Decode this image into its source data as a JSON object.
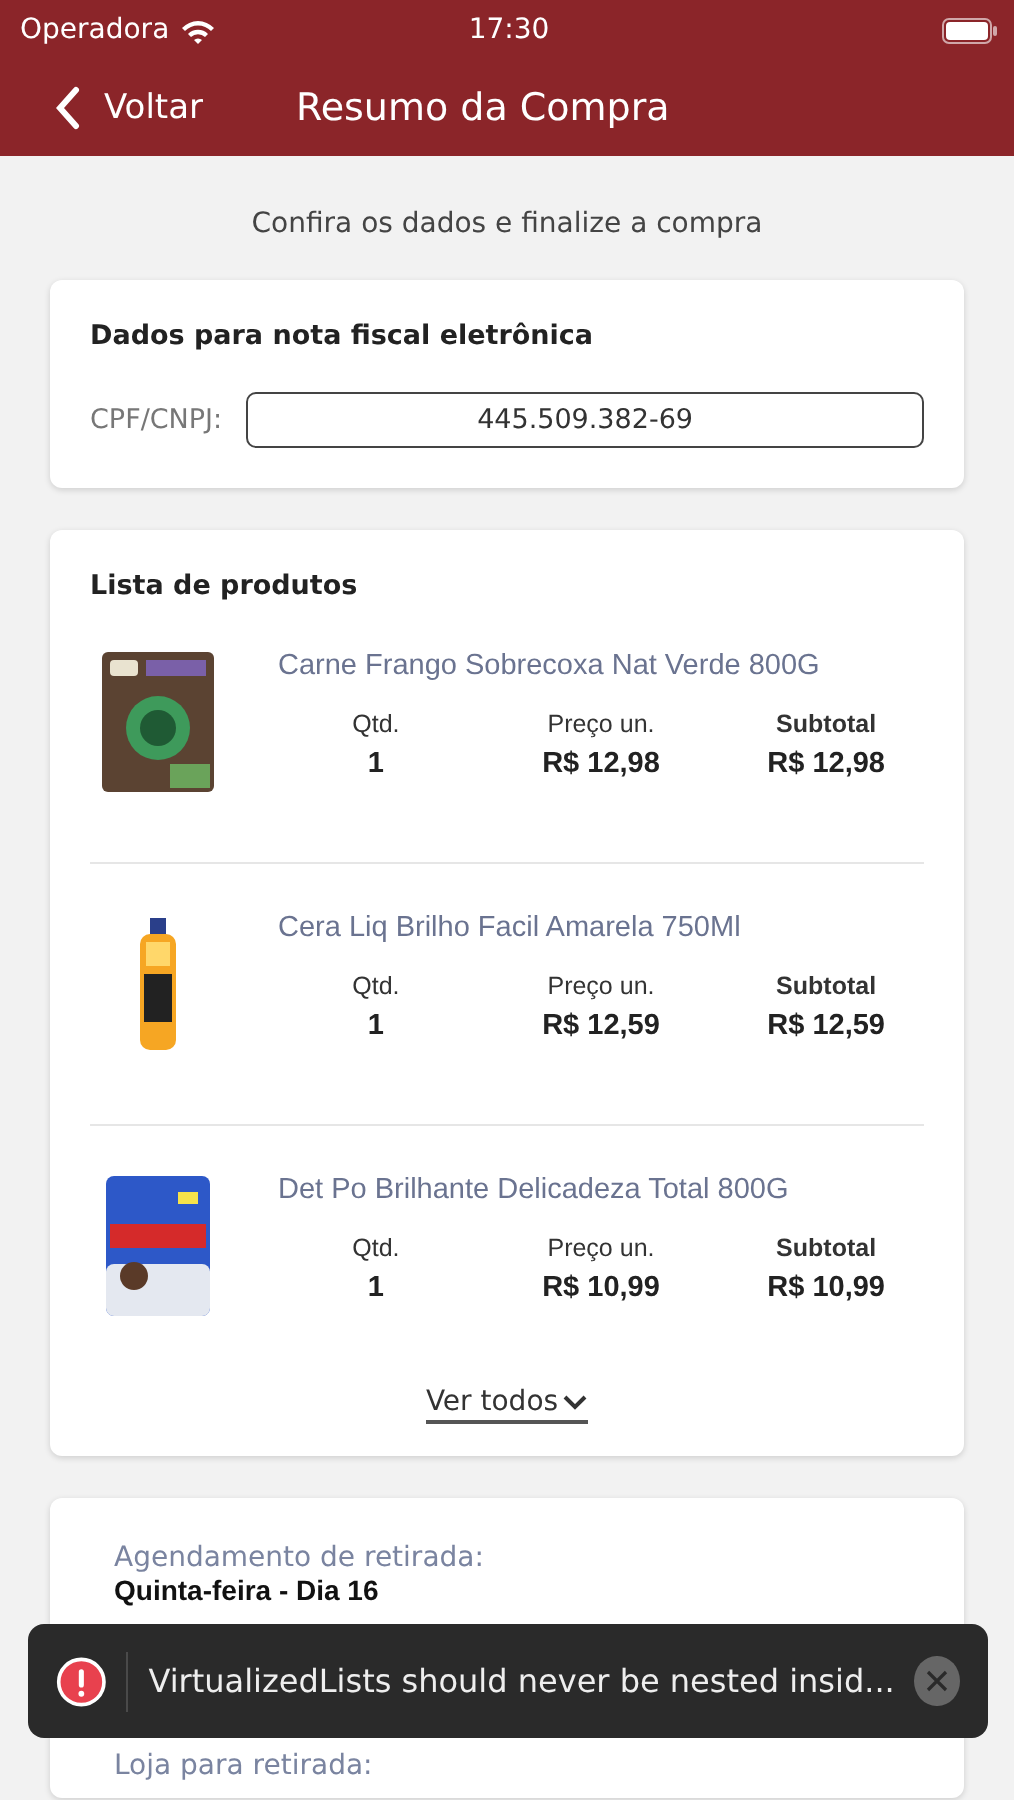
{
  "status_bar": {
    "carrier": "Operadora",
    "time": "17:30"
  },
  "nav": {
    "back_label": "Voltar",
    "title": "Resumo da Compra"
  },
  "subtitle": "Confira os dados e finalize a compra",
  "invoice": {
    "title": "Dados para nota fiscal eletrônica",
    "field_label": "CPF/CNPJ:",
    "field_value": "445.509.382-69"
  },
  "products": {
    "title": "Lista de produtos",
    "items": [
      {
        "name": "Carne Frango Sobrecoxa Nat Verde 800G",
        "qty_label": "Qtd.",
        "qty": "1",
        "price_label": "Preço un.",
        "price": "R$ 12,98",
        "subtotal_label": "Subtotal",
        "subtotal": "R$ 12,98"
      },
      {
        "name": "Cera Liq Brilho Facil Amarela 750Ml",
        "qty_label": "Qtd.",
        "qty": "1",
        "price_label": "Preço un.",
        "price": "R$ 12,59",
        "subtotal_label": "Subtotal",
        "subtotal": "R$ 12,59"
      },
      {
        "name": "Det Po Brilhante Delicadeza Total 800G",
        "qty_label": "Qtd.",
        "qty": "1",
        "price_label": "Preço un.",
        "price": "R$ 10,99",
        "subtotal_label": "Subtotal",
        "subtotal": "R$ 10,99"
      }
    ],
    "see_all": "Ver todos"
  },
  "pickup": {
    "schedule_label": "Agendamento de retirada:",
    "schedule_day": "Quinta-feira - Dia 16",
    "store_label": "Loja para retirada:"
  },
  "toast": {
    "message": "VirtualizedLists should never be nested insid..."
  }
}
